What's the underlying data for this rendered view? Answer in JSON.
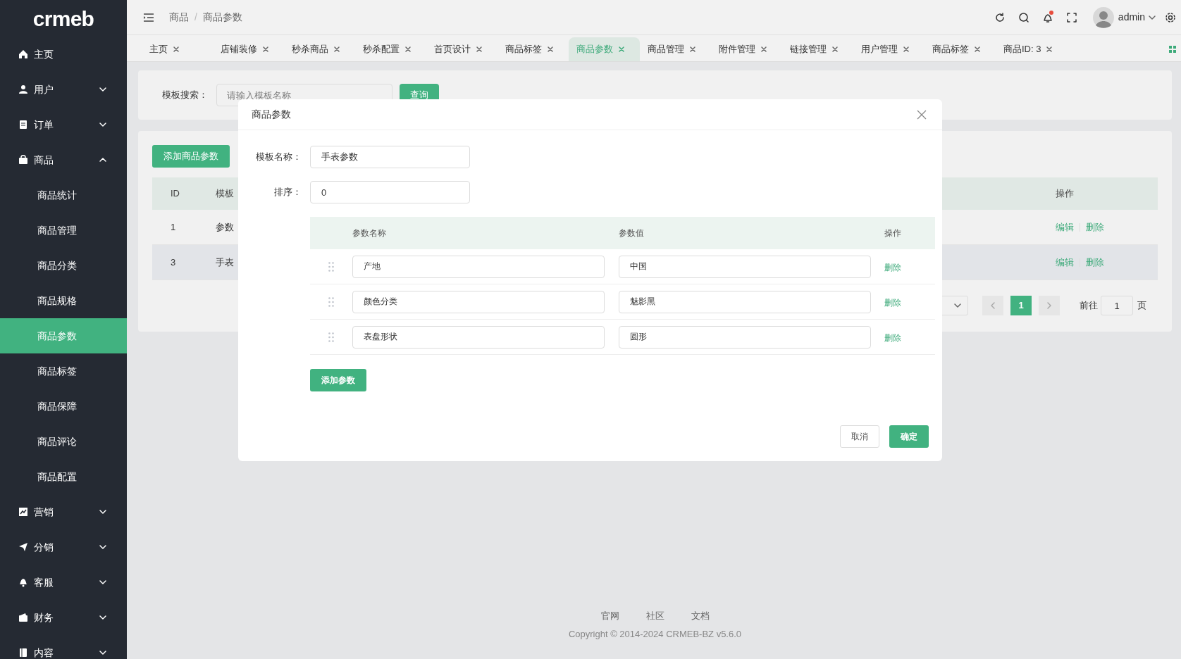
{
  "sidebar": {
    "logo": "crmeb",
    "items": [
      {
        "kind": "link",
        "label": "主页",
        "selected": false
      },
      {
        "kind": "group",
        "label": "用户",
        "expanded": false,
        "selected": false
      },
      {
        "kind": "group",
        "label": "订单",
        "expanded": false,
        "selected": false
      },
      {
        "kind": "group",
        "label": "商品",
        "expanded": true,
        "selected": false,
        "children": [
          {
            "label": "商品统计",
            "selected": false
          },
          {
            "label": "商品管理",
            "selected": false
          },
          {
            "label": "商品分类",
            "selected": false
          },
          {
            "label": "商品规格",
            "selected": false
          },
          {
            "label": "商品参数",
            "selected": true
          },
          {
            "label": "商品标签",
            "selected": false
          },
          {
            "label": "商品保障",
            "selected": false
          },
          {
            "label": "商品评论",
            "selected": false
          },
          {
            "label": "商品配置",
            "selected": false
          }
        ]
      },
      {
        "kind": "group",
        "label": "营销",
        "expanded": false,
        "selected": false
      },
      {
        "kind": "group",
        "label": "分销",
        "expanded": false,
        "selected": false
      },
      {
        "kind": "group",
        "label": "客服",
        "expanded": false,
        "selected": false
      },
      {
        "kind": "group",
        "label": "财务",
        "expanded": false,
        "selected": false
      },
      {
        "kind": "group",
        "label": "内容",
        "expanded": false,
        "selected": false
      }
    ]
  },
  "header": {
    "breadcrumb": [
      "商品",
      "商品参数"
    ],
    "breadcrumb_separator": "/",
    "user": "admin",
    "has_unread": true
  },
  "tabs": [
    {
      "label": "主页",
      "selected": false
    },
    {
      "label": "店铺装修",
      "selected": false
    },
    {
      "label": "秒杀商品",
      "selected": false
    },
    {
      "label": "秒杀配置",
      "selected": false
    },
    {
      "label": "首页设计",
      "selected": false
    },
    {
      "label": "商品标签",
      "selected": false
    },
    {
      "label": "商品参数",
      "selected": true
    },
    {
      "label": "商品管理",
      "selected": false
    },
    {
      "label": "附件管理",
      "selected": false
    },
    {
      "label": "链接管理",
      "selected": false
    },
    {
      "label": "用户管理",
      "selected": false
    },
    {
      "label": "商品标签",
      "selected": false
    },
    {
      "label": "商品ID: 3",
      "selected": false
    }
  ],
  "search": {
    "label": "模板搜索：",
    "placeholder": "请输入模板名称",
    "button": "查询"
  },
  "add_button": "添加商品参数",
  "table": {
    "columns": [
      "ID",
      "模板",
      "操作"
    ],
    "rows": [
      {
        "cells": [
          "1",
          "参数"
        ],
        "actions": [
          "编辑",
          "删除"
        ],
        "highlighted": false
      },
      {
        "cells": [
          "3",
          "手表"
        ],
        "actions": [
          "编辑",
          "删除"
        ],
        "highlighted": true
      }
    ]
  },
  "pagination": {
    "pages": [
      {
        "label": "1",
        "selected": true
      }
    ],
    "jump_label": "前往",
    "jump_value": "1",
    "jump_suffix": "页"
  },
  "modal": {
    "title": "商品参数",
    "fields": [
      {
        "label": "模板名称：",
        "value": "手表参数"
      },
      {
        "label": "排序：",
        "value": "0"
      }
    ],
    "params": {
      "columns": [
        "参数名称",
        "参数值",
        "操作"
      ],
      "rows": [
        {
          "name": "产地",
          "value": "中国",
          "action": "删除"
        },
        {
          "name": "颜色分类",
          "value": "魅影黑",
          "action": "删除"
        },
        {
          "name": "表盘形状",
          "value": "圆形",
          "action": "删除"
        }
      ]
    },
    "add_button": "添加参数",
    "cancel": "取消",
    "confirm": "确定"
  },
  "footer": {
    "links": [
      "官网",
      "社区",
      "文档"
    ],
    "copyright": "Copyright © 2014-2024 CRMEB-BZ v5.6.0"
  }
}
